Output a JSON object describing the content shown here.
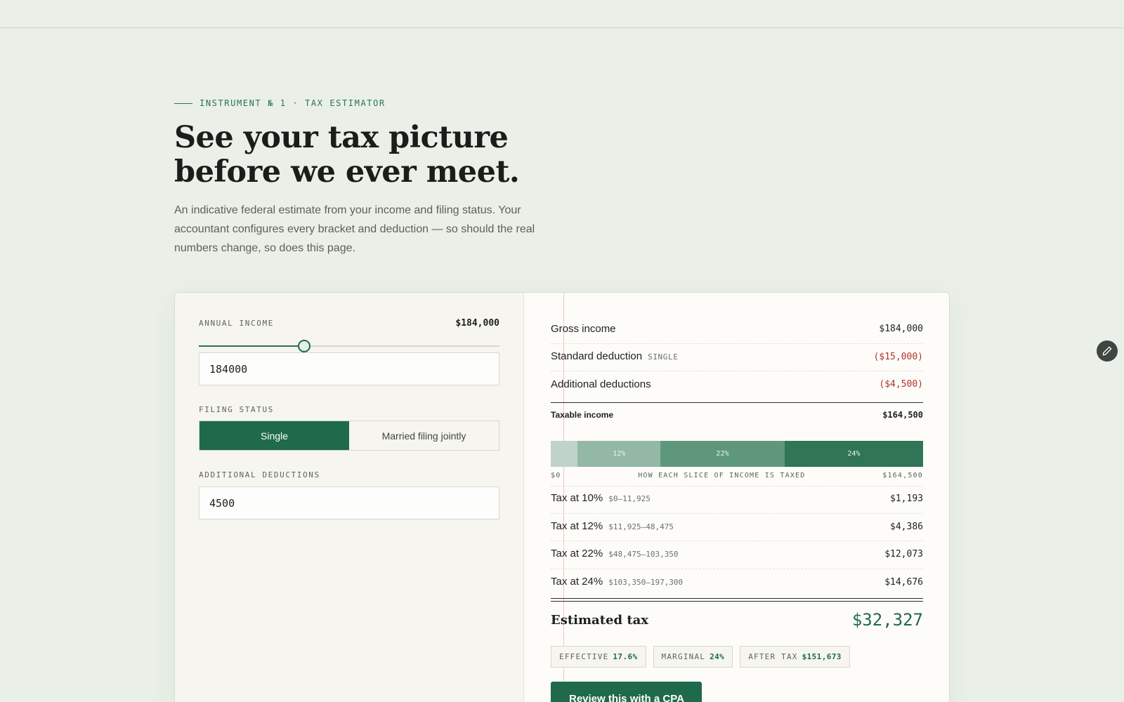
{
  "hero": {
    "eyebrow": "INSTRUMENT № 1 · TAX ESTIMATOR",
    "headline": "See your tax picture before we ever meet.",
    "lede": "An indicative federal estimate from your income and filing status. Your accountant configures every bracket and deduction — so should the real numbers change, so does this page."
  },
  "form": {
    "income_label": "ANNUAL INCOME",
    "income_display": "$184,000",
    "income_slider_fraction": 0.35,
    "income_value": "184000",
    "filing_label": "FILING STATUS",
    "filing_options": [
      "Single",
      "Married filing jointly"
    ],
    "filing_selected": "Single",
    "deductions_label": "ADDITIONAL DEDUCTIONS",
    "deductions_value": "4500"
  },
  "summary": {
    "gross": {
      "label": "Gross income",
      "amount": "$184,000"
    },
    "standard": {
      "label": "Standard deduction",
      "tag": "SINGLE",
      "amount": "($15,000)"
    },
    "additional": {
      "label": "Additional deductions",
      "amount": "($4,500)"
    },
    "taxable": {
      "label": "Taxable income",
      "amount": "$164,500"
    },
    "bar": [
      {
        "label": "",
        "fraction": 0.0725,
        "color": "#bfd3c8"
      },
      {
        "label": "12%",
        "fraction": 0.2222,
        "color": "#93b8a5"
      },
      {
        "label": "22%",
        "fraction": 0.3331,
        "color": "#5f977c"
      },
      {
        "label": "24%",
        "fraction": 0.3722,
        "color": "#2f7556"
      }
    ],
    "scale_left": "$0",
    "scale_caption": "HOW EACH SLICE OF INCOME IS TAXED",
    "scale_right": "$164,500",
    "brackets": [
      {
        "label": "Tax at 10%",
        "range": "$0–11,925",
        "amount": "$1,193"
      },
      {
        "label": "Tax at 12%",
        "range": "$11,925–48,475",
        "amount": "$4,386"
      },
      {
        "label": "Tax at 22%",
        "range": "$48,475–103,350",
        "amount": "$12,073"
      },
      {
        "label": "Tax at 24%",
        "range": "$103,350–197,300",
        "amount": "$14,676"
      }
    ],
    "total": {
      "label": "Estimated tax",
      "amount": "$32,327"
    },
    "chips": [
      {
        "label": "EFFECTIVE",
        "value": "17.6%"
      },
      {
        "label": "MARGINAL",
        "value": "24%"
      },
      {
        "label": "AFTER TAX",
        "value": "$151,673"
      }
    ],
    "cta": "Review this with a CPA"
  },
  "icons": {
    "edit": "pencil-icon",
    "slider": "slider-thumb"
  }
}
